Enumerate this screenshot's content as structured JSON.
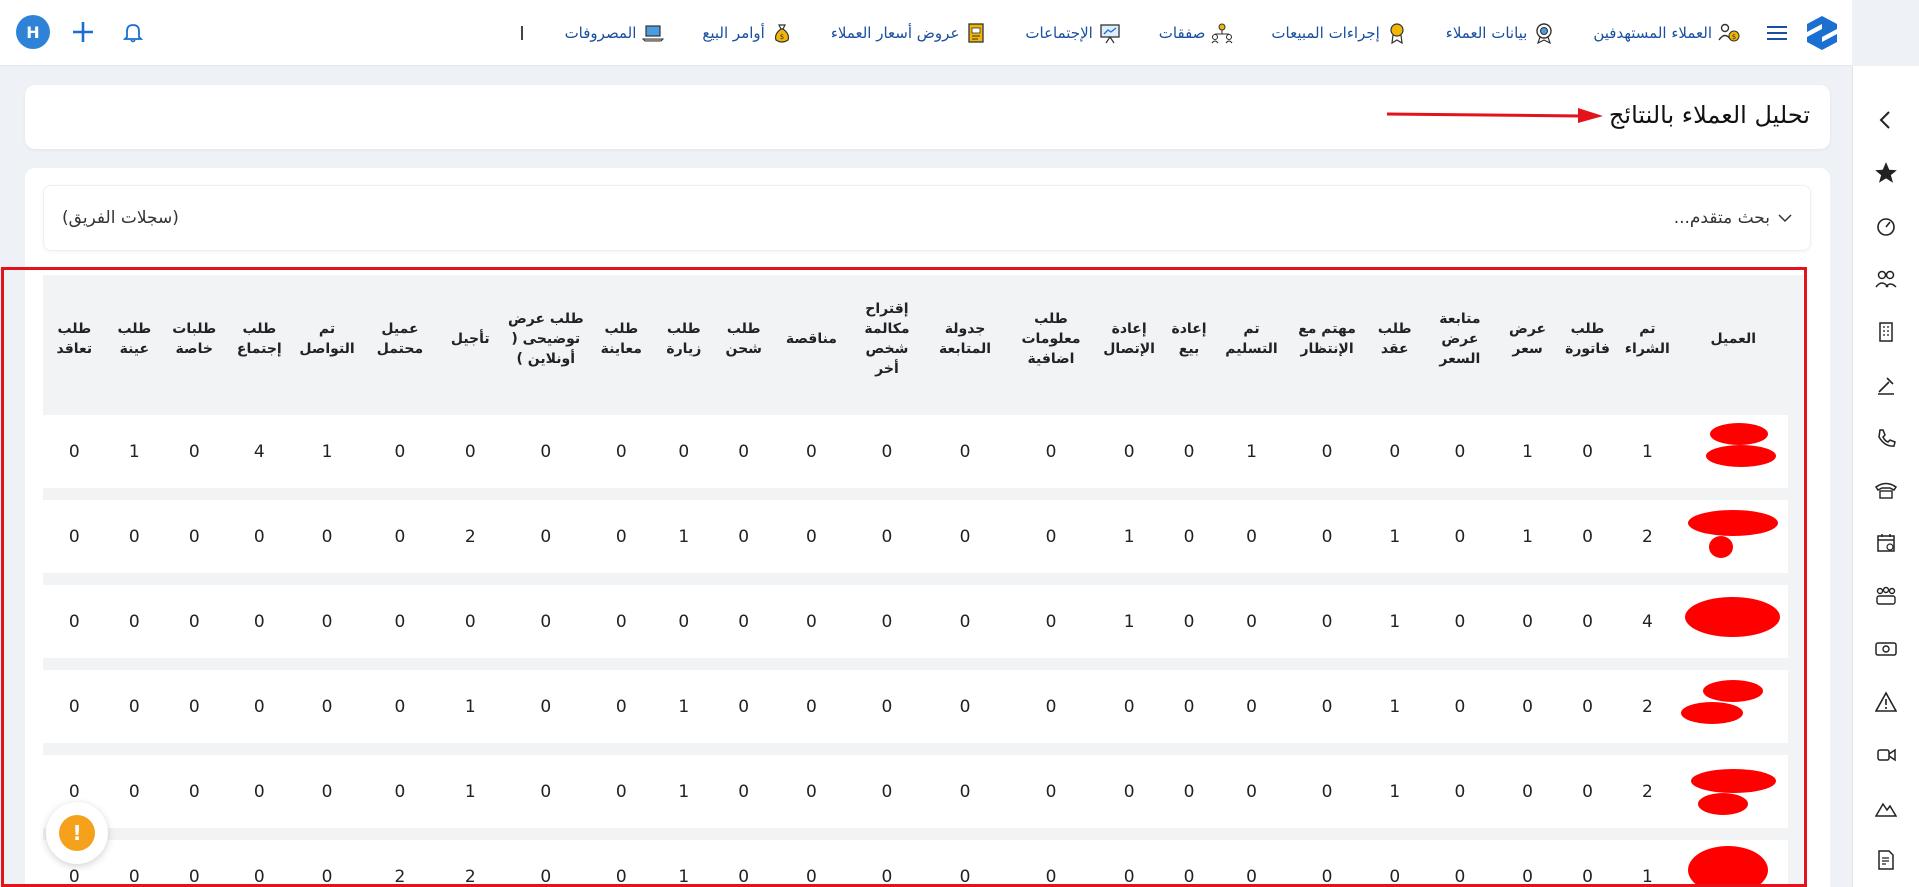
{
  "nav": {
    "items": [
      {
        "label": "العملاء المستهدفين",
        "icon": "people-dollar-icon"
      },
      {
        "label": "بيانات العملاء",
        "icon": "target-icon"
      },
      {
        "label": "إجراءات المبيعات",
        "icon": "award-icon"
      },
      {
        "label": "صفقات",
        "icon": "handshake-icon"
      },
      {
        "label": "الإجتماعات",
        "icon": "presentation-icon"
      },
      {
        "label": "عروض أسعار العملاء",
        "icon": "document-icon"
      },
      {
        "label": "أوامر البيع",
        "icon": "money-bag-icon"
      },
      {
        "label": "المصروفات",
        "icon": "laptop-icon"
      }
    ],
    "avatar_letter": "H"
  },
  "page": {
    "title": "تحليل العملاء بالنتائج",
    "advanced_search": "بحث متقدم...",
    "team_records": "(سجلات الفريق)"
  },
  "table": {
    "headers": [
      "العميل",
      "تم الشراء",
      "طلب فاتورة",
      "عرض سعر",
      "متابعة عرض السعر",
      "طلب عقد",
      "مهتم مع الإنتظار",
      "تم التسليم",
      "إعادة بيع",
      "إعادة الإتصال",
      "طلب معلومات اضافية",
      "جدولة المتابعة",
      "إقتراح مكالمة شخص أخر",
      "مناقصة",
      "طلب شحن",
      "طلب زيارة",
      "طلب معاينة",
      "طلب عرض توضيحى ( أونلاين )",
      "تأجيل",
      "عميل محتمل",
      "تم التواصل",
      "طلب إجتماع",
      "طلبات خاصة",
      "طلب عينة",
      "طلب تعاقد"
    ],
    "rows": [
      [
        "",
        "1",
        "0",
        "1",
        "0",
        "0",
        "0",
        "1",
        "0",
        "0",
        "0",
        "0",
        "0",
        "0",
        "0",
        "0",
        "0",
        "0",
        "0",
        "0",
        "1",
        "4",
        "0",
        "1",
        "0"
      ],
      [
        "",
        "2",
        "0",
        "1",
        "0",
        "1",
        "0",
        "0",
        "0",
        "1",
        "0",
        "0",
        "0",
        "0",
        "0",
        "1",
        "0",
        "0",
        "2",
        "0",
        "0",
        "0",
        "0",
        "0",
        "0"
      ],
      [
        "",
        "4",
        "0",
        "0",
        "0",
        "1",
        "0",
        "0",
        "0",
        "1",
        "0",
        "0",
        "0",
        "0",
        "0",
        "0",
        "0",
        "0",
        "0",
        "0",
        "0",
        "0",
        "0",
        "0",
        "0"
      ],
      [
        "",
        "2",
        "0",
        "0",
        "0",
        "1",
        "0",
        "0",
        "0",
        "0",
        "0",
        "0",
        "0",
        "0",
        "0",
        "1",
        "0",
        "0",
        "1",
        "0",
        "0",
        "0",
        "0",
        "0",
        "0"
      ],
      [
        "",
        "2",
        "0",
        "0",
        "0",
        "1",
        "0",
        "0",
        "0",
        "0",
        "0",
        "0",
        "0",
        "0",
        "0",
        "1",
        "0",
        "0",
        "1",
        "0",
        "0",
        "0",
        "0",
        "0",
        "0"
      ],
      [
        "",
        "1",
        "0",
        "0",
        "0",
        "0",
        "0",
        "0",
        "0",
        "0",
        "0",
        "0",
        "0",
        "0",
        "0",
        "1",
        "0",
        "0",
        "2",
        "2",
        "0",
        "0",
        "0",
        "0",
        "0"
      ]
    ]
  },
  "alert": {
    "symbol": "!"
  },
  "colors": {
    "brand": "#1a6fd1",
    "nav_text": "#1a4fa0",
    "highlight": "#e4131b",
    "alert": "#f5a11c"
  }
}
